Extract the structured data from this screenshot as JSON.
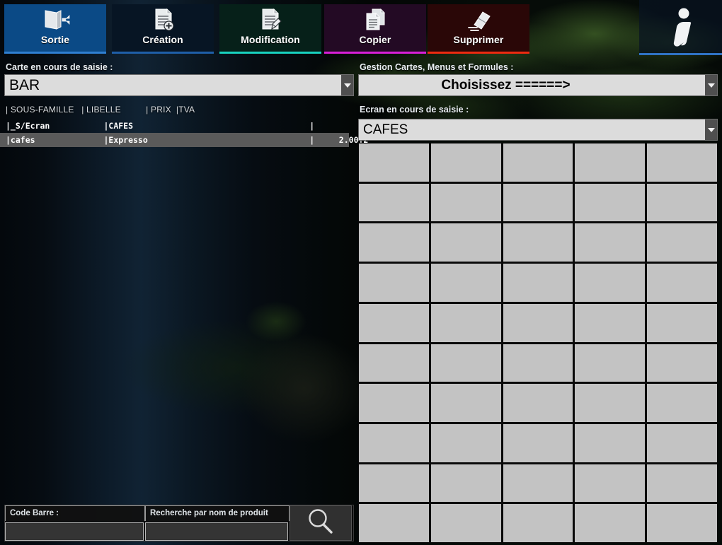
{
  "toolbar": {
    "buttons": [
      {
        "label": "Sortie",
        "icon": "exit-door-icon",
        "bg": "#0b4a86",
        "accent": "#2f7fd1"
      },
      {
        "label": "Création",
        "icon": "document-add-icon",
        "bg": "#071524",
        "accent": "#1f5fa8"
      },
      {
        "label": "Modification",
        "icon": "document-edit-icon",
        "bg": "#062019",
        "accent": "#18d2c0"
      },
      {
        "label": "Copier",
        "icon": "document-copy-icon",
        "bg": "#230a24",
        "accent": "#d81fd8"
      },
      {
        "label": "Supprimer",
        "icon": "eraser-icon",
        "bg": "#2a0707",
        "accent": "#ee2a10"
      },
      {
        "label": "",
        "icon": "info-icon",
        "bg": "rgba(9,20,34,0.72)",
        "accent": "#2f72c4"
      }
    ]
  },
  "left_panel": {
    "card_label": "Carte en cours de saisie :",
    "card_value": "BAR",
    "list_header": "| SOUS-FAMILLE   | LIBELLE          | PRIX  |TVA",
    "list_columns": [
      "SOUS-FAMILLE",
      "LIBELLE",
      "PRIX",
      "TVA"
    ],
    "rows": [
      {
        "type": "group",
        "text": "|_S/Ecran           |CAFES                                    |          |",
        "sous_famille": "_S/Ecran",
        "libelle": "CAFES",
        "prix": "",
        "tva": ""
      },
      {
        "type": "product",
        "text": "|cafes              |Expresso                                 |     2.00|2",
        "sous_famille": "cafes",
        "libelle": "Expresso",
        "prix": "2.00",
        "tva": "2"
      }
    ]
  },
  "search": {
    "barcode_label": "Code Barre :",
    "barcode_value": "",
    "name_label": "Recherche par nom de produit",
    "name_value": "",
    "button_icon": "magnifier-icon"
  },
  "right_panel": {
    "gestion_label": "Gestion Cartes, Menus et Formules  :",
    "gestion_value": "Choisissez  ======>",
    "ecran_label": "Ecran en cours de saisie :",
    "ecran_value": "CAFES",
    "grid": {
      "rows": 10,
      "cols": 5,
      "cell_color": "#c3c3c3",
      "cells": [
        "",
        "",
        "",
        "",
        "",
        "",
        "",
        "",
        "",
        "",
        "",
        "",
        "",
        "",
        "",
        "",
        "",
        "",
        "",
        "",
        "",
        "",
        "",
        "",
        "",
        "",
        "",
        "",
        "",
        "",
        "",
        "",
        "",
        "",
        "",
        "",
        "",
        "",
        "",
        "",
        "",
        "",
        "",
        "",
        "",
        "",
        "",
        "",
        "",
        ""
      ]
    }
  }
}
